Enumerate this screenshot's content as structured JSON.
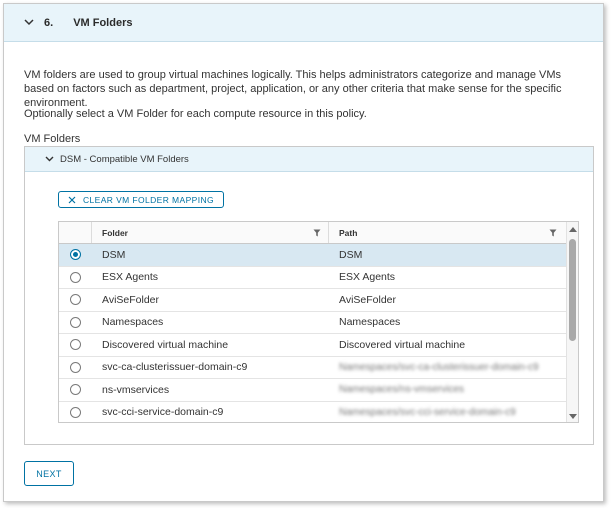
{
  "step": {
    "number": "6.",
    "title": "VM Folders"
  },
  "description": "VM folders are used to group virtual machines logically. This helps administrators categorize and manage VMs based on factors such as department, project, application, or any other criteria that make sense for the specific environment.",
  "optional_text": "Optionally select a VM Folder for each compute resource in this policy.",
  "section_label": "VM Folders",
  "panel": {
    "title": "DSM - Compatible VM Folders",
    "clear_button": "CLEAR VM FOLDER MAPPING"
  },
  "grid": {
    "columns": [
      "Folder",
      "Path"
    ],
    "rows": [
      {
        "folder": "DSM",
        "path": "DSM",
        "selected": true
      },
      {
        "folder": "ESX Agents",
        "path": "ESX Agents",
        "selected": false
      },
      {
        "folder": "AviSeFolder",
        "path": "AviSeFolder",
        "selected": false
      },
      {
        "folder": "Namespaces",
        "path": "Namespaces",
        "selected": false
      },
      {
        "folder": "Discovered virtual machine",
        "path": "Discovered virtual machine",
        "selected": false
      },
      {
        "folder": "svc-ca-clusterissuer-domain-c9",
        "path": "Namespaces/svc-ca-clusterissuer-domain-c9",
        "selected": false
      },
      {
        "folder": "ns-vmservices",
        "path": "Namespaces/ns-vmservices",
        "selected": false
      },
      {
        "folder": "svc-cci-service-domain-c9",
        "path": "Namespaces/svc-cci-service-domain-c9",
        "selected": false
      }
    ]
  },
  "next_button": "NEXT",
  "colors": {
    "accent": "#0072a3",
    "header_bg": "#e8f4fa",
    "selected_row": "#d8e8f2"
  }
}
